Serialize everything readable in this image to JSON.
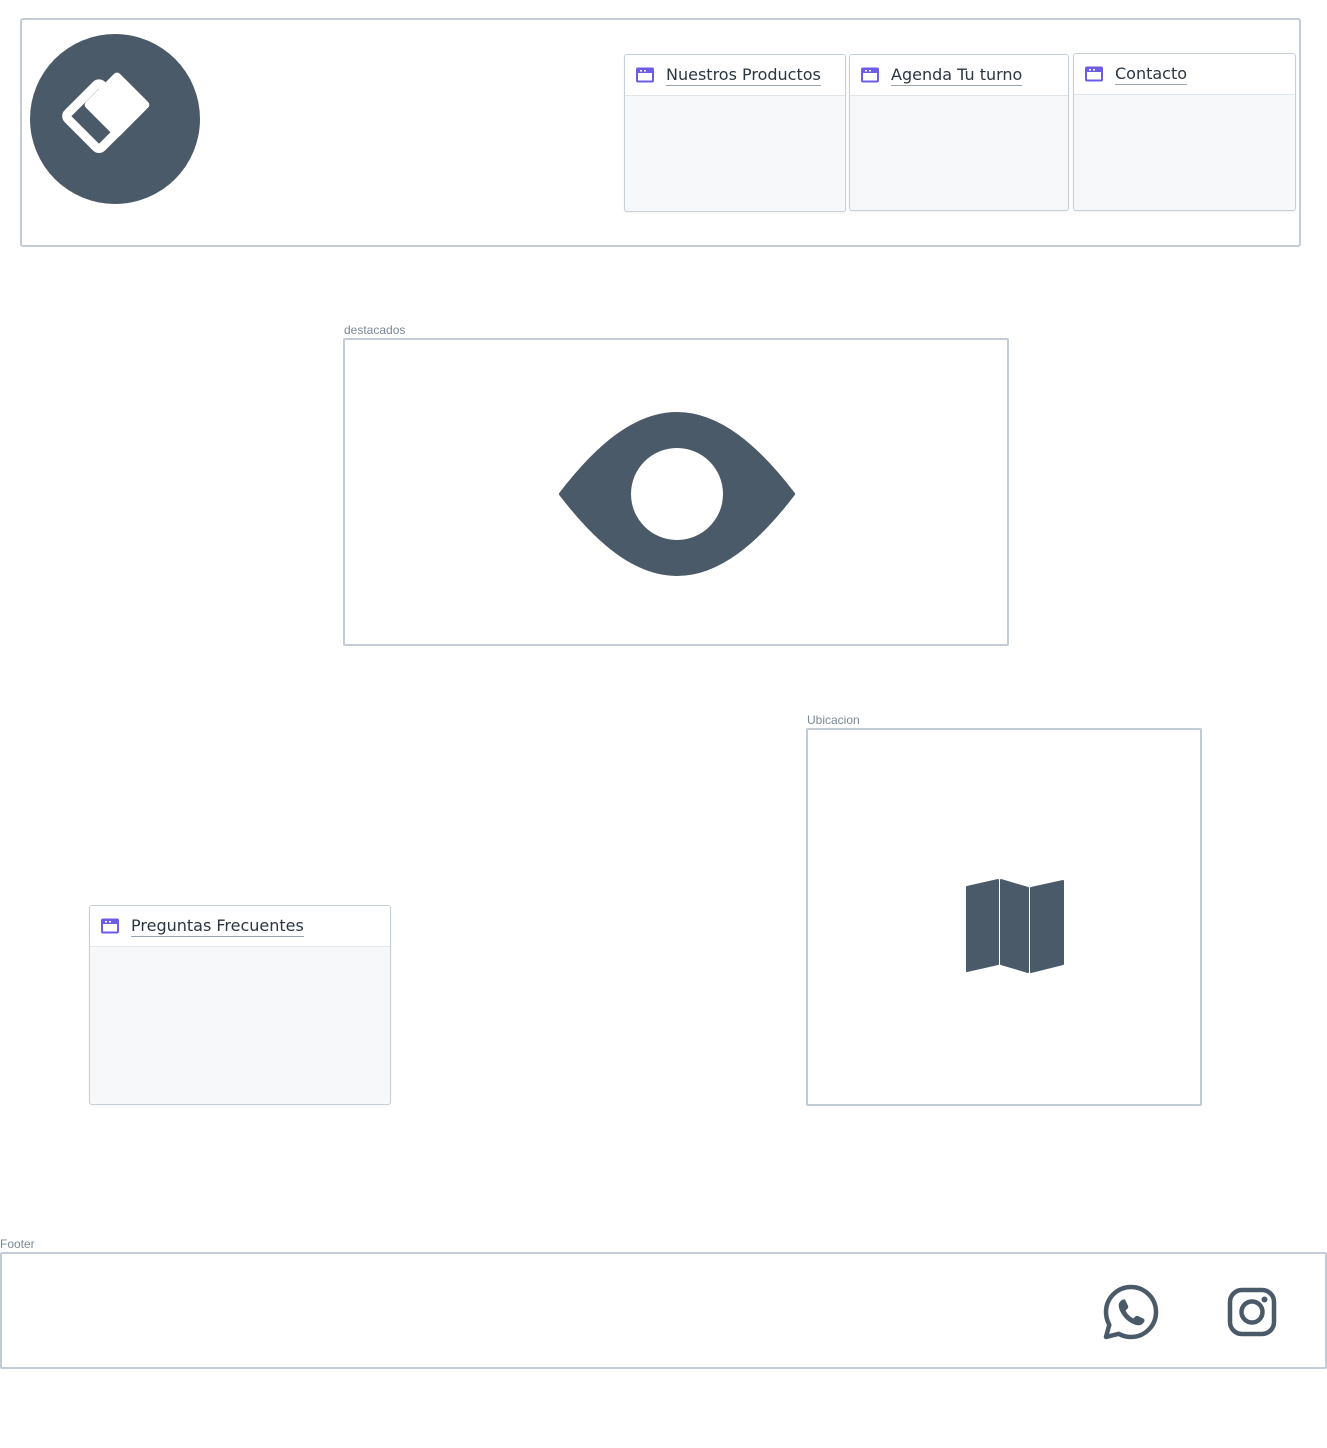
{
  "header": {
    "logo_icon": "diamond-logo-icon",
    "nav_cards": [
      {
        "label": "Nuestros Productos",
        "icon": "browser-window-icon"
      },
      {
        "label": "Agenda Tu turno",
        "icon": "browser-window-icon"
      },
      {
        "label": "Contacto",
        "icon": "browser-window-icon"
      }
    ]
  },
  "destacados": {
    "caption": "destacados",
    "icon": "eye-icon"
  },
  "faq": {
    "label": "Preguntas Frecuentes",
    "icon": "browser-window-icon"
  },
  "ubicacion": {
    "caption": "Ubicacion",
    "icon": "map-icon"
  },
  "footer": {
    "caption": "Footer",
    "icons": [
      "whatsapp-icon",
      "instagram-icon"
    ]
  },
  "colors": {
    "icon_fill": "#4b5a68",
    "accent": "#6c5ce7",
    "border": "#c3ccd4"
  }
}
